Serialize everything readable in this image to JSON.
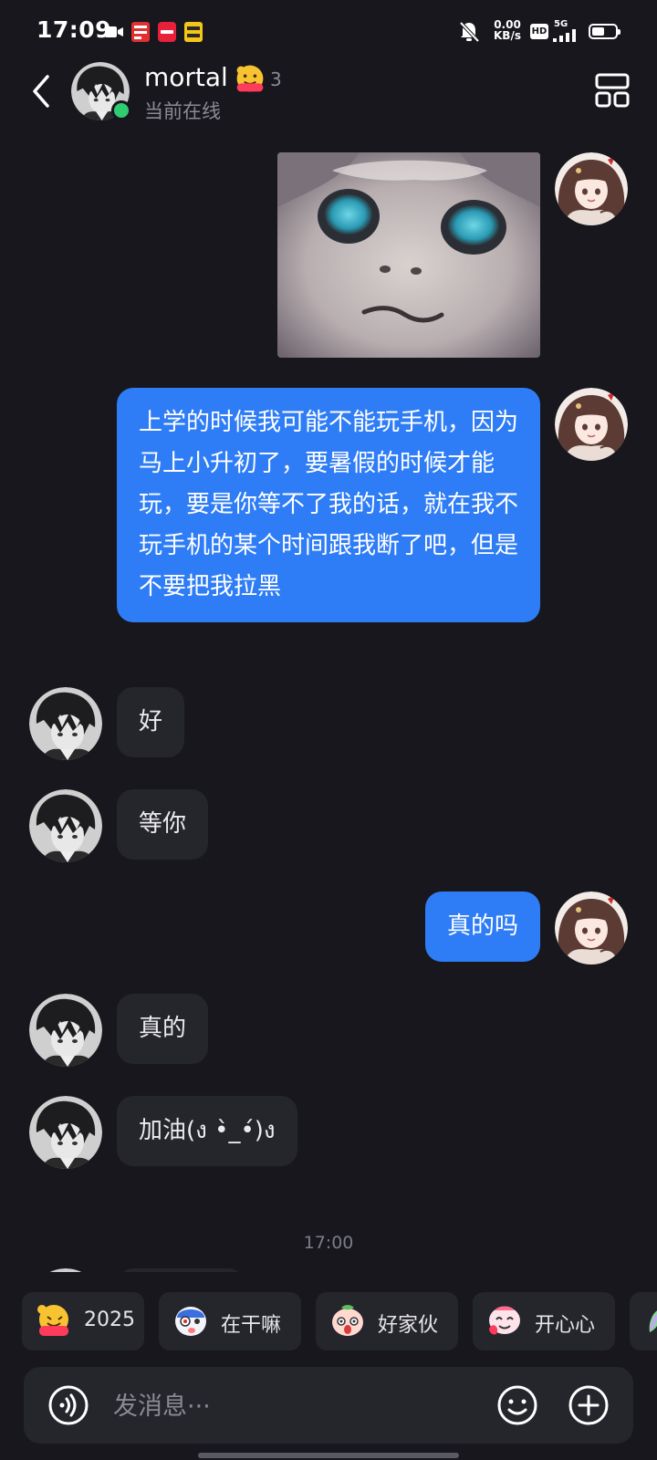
{
  "status_bar": {
    "time": "17:09",
    "net_speed_value": "0.00",
    "net_speed_unit": "KB/s",
    "hd_label": "HD",
    "network": "5G",
    "battery_level": 0.55,
    "app_icons": [
      "video-record-icon",
      "app-notification-icon-1",
      "app-notification-icon-2",
      "app-notification-icon-3"
    ]
  },
  "header": {
    "contact_name": "mortal",
    "streak_count": "3",
    "status": "当前在线",
    "online_color": "#2fcc71"
  },
  "messages": [
    {
      "side": "sent",
      "type": "image",
      "description_icon": "photo-message"
    },
    {
      "side": "sent",
      "type": "text",
      "text": "上学的时候我可能不能玩手机，因为马上小升初了，要暑假的时候才能玩，要是你等不了我的话，就在我不玩手机的某个时间跟我断了吧，但是不要把我拉黑"
    },
    {
      "side": "recv",
      "type": "text",
      "text": "好"
    },
    {
      "side": "recv",
      "type": "text",
      "text": "等你"
    },
    {
      "side": "sent",
      "type": "text",
      "text": "真的吗"
    },
    {
      "side": "recv",
      "type": "text",
      "text": "真的"
    },
    {
      "side": "recv",
      "type": "text",
      "text": "加油(ง •̀_•́)ง"
    }
  ],
  "timestamp": "17:00",
  "quick_replies": [
    {
      "label": "2025",
      "icon": "new-year-emoji-icon"
    },
    {
      "label": "在干嘛",
      "icon": "curious-emoji-icon"
    },
    {
      "label": "好家伙",
      "icon": "shocked-emoji-icon"
    },
    {
      "label": "开心心",
      "icon": "happy-emoji-icon"
    }
  ],
  "input": {
    "placeholder": "发消息···"
  },
  "colors": {
    "background": "#17171d",
    "sent_bubble": "#2f7df6",
    "received_bubble": "#25252c",
    "secondary_text": "#8a8a93"
  }
}
